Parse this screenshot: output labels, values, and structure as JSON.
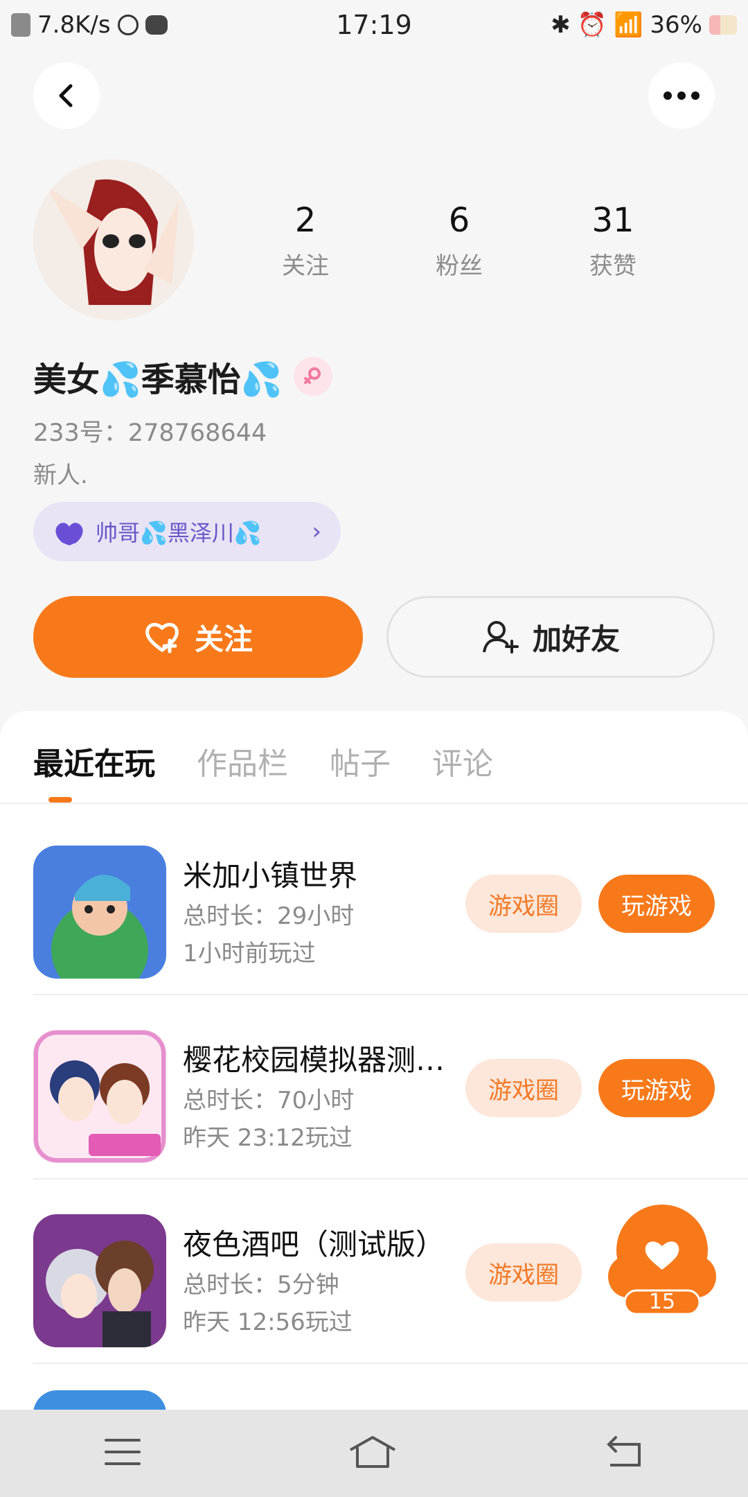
{
  "status_bar": {
    "net_speed": "7.8K/s",
    "time": "17:19",
    "battery": "36%"
  },
  "profile": {
    "stats": [
      {
        "value": "2",
        "label": "关注"
      },
      {
        "value": "6",
        "label": "粉丝"
      },
      {
        "value": "31",
        "label": "获赞"
      }
    ],
    "nickname": "美女💦季慕怡💦",
    "id_line": "233号：278768644",
    "bio": "新人.",
    "cp_tag": "帅哥💦黑泽川💦",
    "follow_label": "关注",
    "add_friend_label": "加好友"
  },
  "tabs": [
    "最近在玩",
    "作品栏",
    "帖子",
    "评论"
  ],
  "games": [
    {
      "title": "米加小镇世界",
      "duration": "总时长：29小时",
      "last_played": "1小时前玩过",
      "circle_label": "游戏圈",
      "play_label": "玩游戏"
    },
    {
      "title": "樱花校园模拟器测…",
      "duration": "总时长：70小时",
      "last_played": "昨天 23:12玩过",
      "circle_label": "游戏圈",
      "play_label": "玩游戏"
    },
    {
      "title": "夜色酒吧（测试版）",
      "duration": "总时长：5分钟",
      "last_played": "昨天 12:56玩过",
      "circle_label": "游戏圈"
    }
  ],
  "float_like_count": "15",
  "colors": {
    "accent": "#f7791a",
    "tag_bg": "#e8e4f6",
    "tag_text": "#6a58c8"
  }
}
